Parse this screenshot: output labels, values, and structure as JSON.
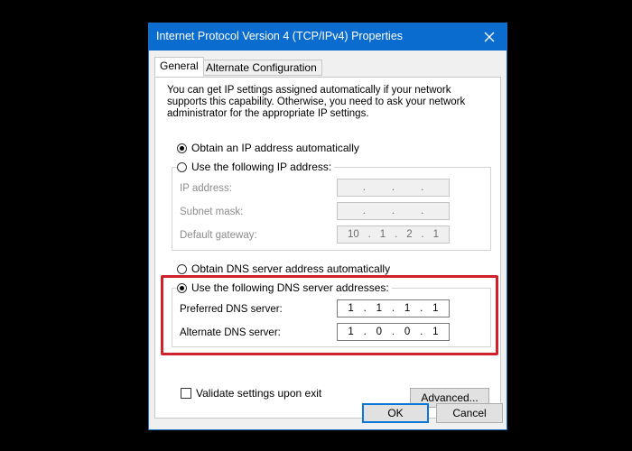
{
  "window": {
    "title": "Internet Protocol Version 4 (TCP/IPv4) Properties",
    "close_icon": "close-icon"
  },
  "tabs": [
    {
      "label": "General",
      "active": true
    },
    {
      "label": "Alternate Configuration",
      "active": false
    }
  ],
  "description": "You can get IP settings assigned automatically if your network supports this capability. Otherwise, you need to ask your network administrator for the appropriate IP settings.",
  "ip": {
    "auto_label": "Obtain an IP address automatically",
    "auto_selected": true,
    "manual_label": "Use the following IP address:",
    "manual_selected": false,
    "fields": [
      {
        "label": "IP address:",
        "octets": [
          "",
          "",
          "",
          ""
        ]
      },
      {
        "label": "Subnet mask:",
        "octets": [
          "",
          "",
          "",
          ""
        ]
      },
      {
        "label": "Default gateway:",
        "octets": [
          "10",
          "1",
          "2",
          "1"
        ]
      }
    ]
  },
  "dns": {
    "auto_label": "Obtain DNS server address automatically",
    "auto_selected": false,
    "manual_label": "Use the following DNS server addresses:",
    "manual_selected": true,
    "fields": [
      {
        "label": "Preferred DNS server:",
        "octets": [
          "1",
          "1",
          "1",
          "1"
        ]
      },
      {
        "label": "Alternate DNS server:",
        "octets": [
          "1",
          "0",
          "0",
          "1"
        ]
      }
    ]
  },
  "validate": {
    "label": "Validate settings upon exit",
    "checked": false
  },
  "buttons": {
    "advanced": "Advanced...",
    "ok": "OK",
    "cancel": "Cancel"
  },
  "colors": {
    "titlebar": "#0b6cd0",
    "highlight": "#d0212a"
  }
}
